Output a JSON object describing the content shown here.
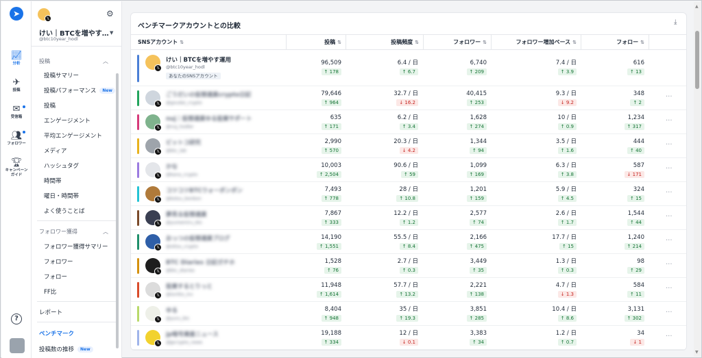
{
  "rail": {
    "items": [
      {
        "label": "分析",
        "icon": "chart-icon"
      },
      {
        "label": "投稿",
        "icon": "send-icon"
      },
      {
        "label": "受信箱",
        "icon": "inbox-icon"
      },
      {
        "label": "フォロワー",
        "icon": "users-icon"
      },
      {
        "label": "キャンペーン\nガイド",
        "icon": "trophy-icon"
      }
    ],
    "help_icon": "?",
    "accent": "#1a73e8"
  },
  "account": {
    "name": "けい｜BTCを増やす…",
    "handle": "@btc10year_hodl"
  },
  "sidebar": {
    "section_posts": "投稿",
    "posts_items": [
      "投稿サマリー",
      "投稿パフォーマンス",
      "投稿",
      "エンゲージメント",
      "平均エンゲージメント",
      "メディア",
      "ハッシュタグ",
      "時間帯",
      "曜日・時間帯",
      "よく使うことば"
    ],
    "new_badge": "New",
    "section_followers": "フォロワー獲得",
    "follower_items": [
      "フォロワー獲得サマリー",
      "フォロワー",
      "フォロー",
      "FF比"
    ],
    "report": "レポート",
    "benchmark": "ベンチマーク",
    "post_count_trend": "投稿数の推移"
  },
  "main": {
    "title": "ベンチマークアカウントとの比較",
    "columns": {
      "account": "SNSアカウント",
      "posts": "投稿",
      "frequency": "投稿頻度",
      "followers": "フォロワー",
      "growth": "フォロワー増加ペース",
      "following": "フォロー",
      "sort": "⇅"
    },
    "rows": [
      {
        "name": "けい｜BTCを増やす運用",
        "handle": "@btc10year_hodl",
        "tag": "あなたのSNSアカウント",
        "color": "#4a7fd6",
        "avatar": "#f5c25b",
        "posts": "96,509",
        "posts_d": "178",
        "posts_up": true,
        "freq": "6.4 / 日",
        "freq_d": "6.7",
        "freq_up": true,
        "fol": "6,740",
        "fol_d": "209",
        "fol_up": true,
        "grow": "7.4 / 日",
        "grow_d": "3.9",
        "grow_up": true,
        "fw": "616",
        "fw_d": "13",
        "fw_up": true
      },
      {
        "name": "ごうだいの仮想通貨crypto日記",
        "handle": "@goudai_crypto",
        "tag": "",
        "color": "#22a45d",
        "avatar": "#cfd6de",
        "posts": "79,646",
        "posts_d": "964",
        "posts_up": true,
        "freq": "32.7 / 日",
        "freq_d": "16.2",
        "freq_up": false,
        "fol": "40,415",
        "fol_d": "253",
        "fol_up": true,
        "grow": "9.3 / 日",
        "grow_d": "9.2",
        "grow_up": false,
        "fw": "348",
        "fw_d": "2",
        "fw_up": true
      },
      {
        "name": "nuj｜仮想通貨ゆる投資サポート",
        "handle": "@nuj_hodler",
        "tag": "",
        "color": "#d63a7a",
        "avatar": "#7fb38d",
        "posts": "635",
        "posts_d": "171",
        "posts_up": true,
        "freq": "6.2 / 日",
        "freq_d": "3.4",
        "freq_up": true,
        "fol": "1,628",
        "fol_d": "274",
        "fol_up": true,
        "grow": "10 / 日",
        "grow_d": "0.9",
        "grow_up": true,
        "fw": "1,234",
        "fw_d": "317",
        "fw_up": true
      },
      {
        "name": "ビットコ研究",
        "handle": "@btc_lab",
        "tag": "",
        "color": "#e8b21d",
        "avatar": "#9ea4ab",
        "posts": "2,990",
        "posts_d": "570",
        "posts_up": true,
        "freq": "20.3 / 日",
        "freq_d": "4.2",
        "freq_up": false,
        "fol": "1,344",
        "fol_d": "94",
        "fol_up": true,
        "grow": "3.5 / 日",
        "grow_d": "1.6",
        "grow_up": true,
        "fw": "444",
        "fw_d": "40",
        "fw_up": true
      },
      {
        "name": "かな",
        "handle": "@kana_crypto",
        "tag": "",
        "color": "#9b7be0",
        "avatar": "#e4e6ea",
        "posts": "10,003",
        "posts_d": "2,504",
        "posts_up": true,
        "freq": "90.6 / 日",
        "freq_d": "59",
        "freq_up": true,
        "fol": "1,099",
        "fol_d": "169",
        "fol_up": true,
        "grow": "6.3 / 日",
        "grow_d": "3.8",
        "grow_up": true,
        "fw": "587",
        "fw_d": "171",
        "fw_up": false
      },
      {
        "name": "コツコツBTCウォーボンボン",
        "handle": "@kotsu_bonbon",
        "tag": "",
        "color": "#24c3d4",
        "avatar": "#b07a3a",
        "posts": "7,493",
        "posts_d": "778",
        "posts_up": true,
        "freq": "28 / 日",
        "freq_d": "10.8",
        "freq_up": true,
        "fol": "1,201",
        "fol_d": "159",
        "fol_up": true,
        "grow": "5.9 / 日",
        "grow_d": "4.5",
        "grow_up": true,
        "fw": "324",
        "fw_d": "15",
        "fw_up": true
      },
      {
        "name": "夢見る仮想通貨",
        "handle": "@yumemiru_btc",
        "tag": "",
        "color": "#7a4a2a",
        "avatar": "#3a3f52",
        "posts": "7,867",
        "posts_d": "333",
        "posts_up": true,
        "freq": "12.2 / 日",
        "freq_d": "1.2",
        "freq_up": true,
        "fol": "2,577",
        "fol_d": "74",
        "fol_up": true,
        "grow": "2.6 / 日",
        "grow_d": "1.7",
        "grow_up": true,
        "fw": "1,544",
        "fw_d": "44",
        "fw_up": true
      },
      {
        "name": "おっつの仮想通貨ブログ",
        "handle": "@ottsu_crypto",
        "tag": "",
        "color": "#1f8f6a",
        "avatar": "#2f5fa8",
        "posts": "14,190",
        "posts_d": "1,551",
        "posts_up": true,
        "freq": "55.5 / 日",
        "freq_d": "8.4",
        "freq_up": true,
        "fol": "2,166",
        "fol_d": "475",
        "fol_up": true,
        "grow": "17.7 / 日",
        "grow_d": "15",
        "grow_up": true,
        "fw": "1,240",
        "fw_d": "214",
        "fw_up": true
      },
      {
        "name": "BTC Diaries 日記ガチホ",
        "handle": "@btc_diaries",
        "tag": "",
        "color": "#d4900d",
        "avatar": "#1e1e1e",
        "posts": "1,528",
        "posts_d": "76",
        "posts_up": true,
        "freq": "2.7 / 日",
        "freq_d": "0.3",
        "freq_up": true,
        "fol": "3,449",
        "fol_d": "35",
        "fol_up": true,
        "grow": "1.3 / 日",
        "grow_d": "0.3",
        "grow_up": true,
        "fw": "98",
        "fw_d": "29",
        "fw_up": true
      },
      {
        "name": "投資するとりっと",
        "handle": "@toritto_inv",
        "tag": "",
        "color": "#d94b2b",
        "avatar": "#dcdcdc",
        "posts": "11,948",
        "posts_d": "1,614",
        "posts_up": true,
        "freq": "57.7 / 日",
        "freq_d": "13.2",
        "freq_up": true,
        "fol": "2,221",
        "fol_d": "138",
        "fol_up": true,
        "grow": "4.7 / 日",
        "grow_d": "1.3",
        "grow_up": false,
        "fw": "584",
        "fw_d": "11",
        "fw_up": true
      },
      {
        "name": "ゆる",
        "handle": "@yuru_btc",
        "tag": "",
        "color": "#b8d96a",
        "avatar": "#eef0e8",
        "posts": "8,404",
        "posts_d": "948",
        "posts_up": true,
        "freq": "35 / 日",
        "freq_d": "19.3",
        "freq_up": true,
        "fol": "3,851",
        "fol_d": "285",
        "fol_up": true,
        "grow": "10.4 / 日",
        "grow_d": "8.6",
        "grow_up": true,
        "fw": "3,131",
        "fw_d": "302",
        "fw_up": true
      },
      {
        "name": "jp暗号資産ニュース",
        "handle": "@jpcrypto_news",
        "tag": "",
        "color": "#9fb4ea",
        "avatar": "#f2d22e",
        "posts": "19,188",
        "posts_d": "334",
        "posts_up": true,
        "freq": "12 / 日",
        "freq_d": "0.1",
        "freq_up": false,
        "fol": "3,383",
        "fol_d": "34",
        "fol_up": true,
        "grow": "1.2 / 日",
        "grow_d": "0.7",
        "grow_up": true,
        "fw": "34",
        "fw_d": "1",
        "fw_up": false
      }
    ]
  }
}
